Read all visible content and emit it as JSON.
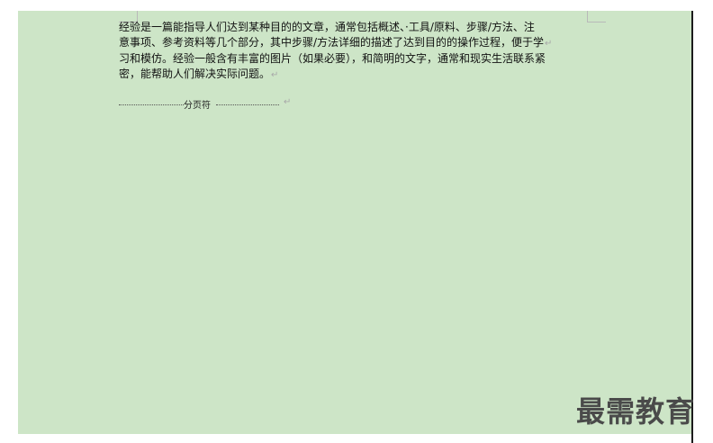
{
  "document": {
    "paragraph_lines": [
      "经验是一篇能指导人们达到某种目的的文章，通常包括概述、·工具/原料、步骤/方法、注",
      "意事项、参考资料等几个部分，其中步骤/方法详细的描述了达到目的的操作过程，便于学",
      "习和模仿。经验一般含有丰富的图片（如果必要），和简明的文字，通常和现实生活联系紧",
      "密，能帮助人们解决实际问题。"
    ],
    "paragraph_mark": "↵",
    "page_break_label": "分页符"
  },
  "watermark": {
    "text": "最需教育"
  },
  "colors": {
    "page_background": "#cde5c7",
    "text": "#111111"
  }
}
